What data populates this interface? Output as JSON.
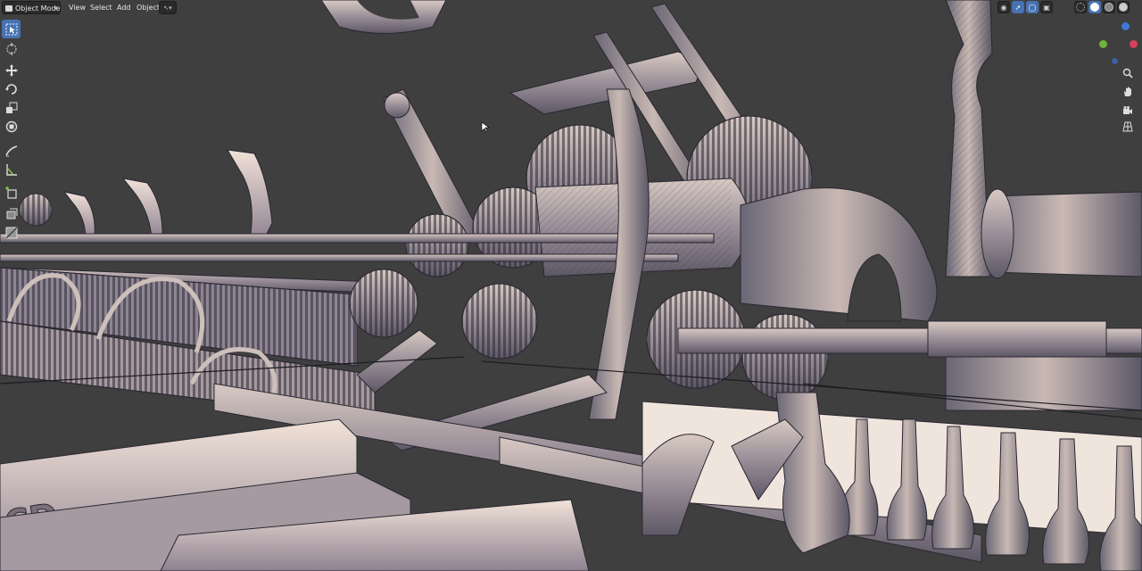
{
  "app": "Blender",
  "header": {
    "mode": "Object Mode",
    "menus": [
      "View",
      "Select",
      "Add",
      "Object"
    ]
  },
  "toolbar": {
    "tools": [
      {
        "name": "select-box-icon",
        "active": true
      },
      {
        "name": "cursor-icon",
        "active": false
      },
      {
        "name": "move-icon",
        "active": false
      },
      {
        "name": "rotate-icon",
        "active": false
      },
      {
        "name": "scale-icon",
        "active": false
      },
      {
        "name": "transform-icon",
        "active": false
      },
      {
        "name": "annotate-icon",
        "active": false
      },
      {
        "name": "measure-icon",
        "active": false
      },
      {
        "name": "add-cube-icon",
        "active": false
      },
      {
        "name": "extrude-icon",
        "active": false
      },
      {
        "name": "shear-icon",
        "active": false
      }
    ]
  },
  "viewport_header": {
    "shading_modes": [
      "wireframe-shading-icon",
      "solid-shading-icon",
      "material-shading-icon",
      "rendered-shading-icon"
    ],
    "active_shading": "solid-shading-icon"
  },
  "nav_gizmo": {
    "axes": [
      "X",
      "Y",
      "Z"
    ]
  },
  "colors": {
    "accent": "#4772b3",
    "background": "#3f3f3f",
    "axis_x": "#d7415a",
    "axis_y": "#6fb33a",
    "axis_z": "#3d78d6"
  }
}
